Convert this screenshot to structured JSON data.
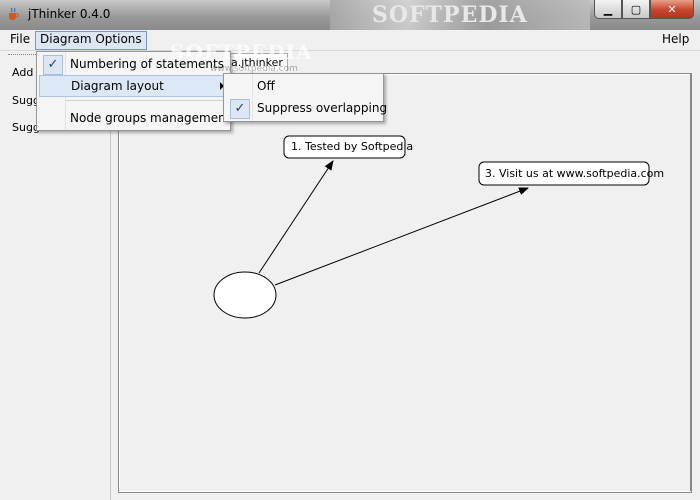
{
  "window": {
    "title": "jThinker 0.4.0",
    "watermark": "SOFTPEDIA"
  },
  "menubar": {
    "file": "File",
    "diagram_options": "Diagram Options",
    "help": "Help"
  },
  "left_panel": {
    "items": [
      "Add n",
      "Sugg",
      "Sugg"
    ]
  },
  "tab": {
    "label": "a.jthinker"
  },
  "diagram_menu": {
    "numbering": {
      "label": "Numbering of statements",
      "checked": true
    },
    "layout": {
      "label": "Diagram layout"
    },
    "node_groups": {
      "label": "Node groups management"
    }
  },
  "layout_menu": {
    "off": {
      "label": "Off",
      "checked": false
    },
    "suppress": {
      "label": "Suppress overlapping",
      "checked": true
    }
  },
  "nodes": [
    {
      "label": "1. Tested by Softpedia"
    },
    {
      "label": "3. Visit us at www.softpedia.com"
    }
  ],
  "overlay_watermark": {
    "big": "SOFTPEDIA",
    "small": "www.softpedia.com"
  }
}
